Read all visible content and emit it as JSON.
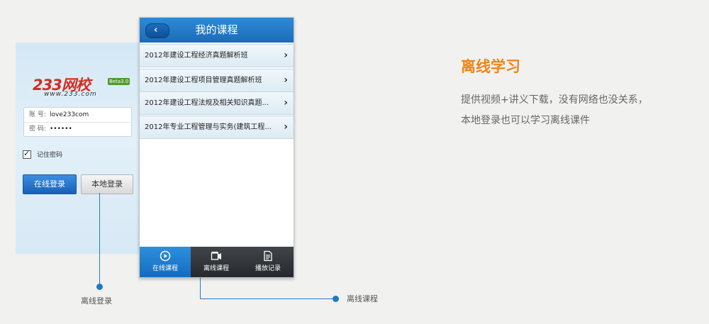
{
  "login": {
    "logo_text": "233网校",
    "logo_badge": "Beta3.0",
    "logo_url": "www.233.com",
    "account_label": "账 号:",
    "account_value": "love233com",
    "password_label": "密 码:",
    "password_value": "••••••",
    "remember_label": "记住密码",
    "online_login_button": "在线登录",
    "local_login_button": "本地登录"
  },
  "course": {
    "title": "我的课程",
    "back_glyph": "‹",
    "items": [
      {
        "name": "2012年建设工程经济真题解析班"
      },
      {
        "name": "2012年建设工程项目管理真题解析班"
      },
      {
        "name": "2012年建设工程法规及相关知识真题..."
      },
      {
        "name": "2012年专业工程管理与实务(建筑工程..."
      }
    ],
    "arrow_glyph": "›",
    "tabs": [
      {
        "label": "在线课程",
        "icon": "play-icon",
        "active": true
      },
      {
        "label": "离线课程",
        "icon": "offline-icon",
        "active": false
      },
      {
        "label": "播放记录",
        "icon": "history-icon",
        "active": false
      }
    ]
  },
  "callouts": {
    "offline_login": "离线登录",
    "offline_course": "离线课程"
  },
  "section": {
    "title": "离线学习",
    "description": "提供视频+讲义下载，没有网络也没关系，本地登录也可以学习离线课件"
  },
  "colors": {
    "accent_orange": "#f08417",
    "primary_blue": "#1c6cb8",
    "tab_bar_dark": "#2b2f33"
  }
}
